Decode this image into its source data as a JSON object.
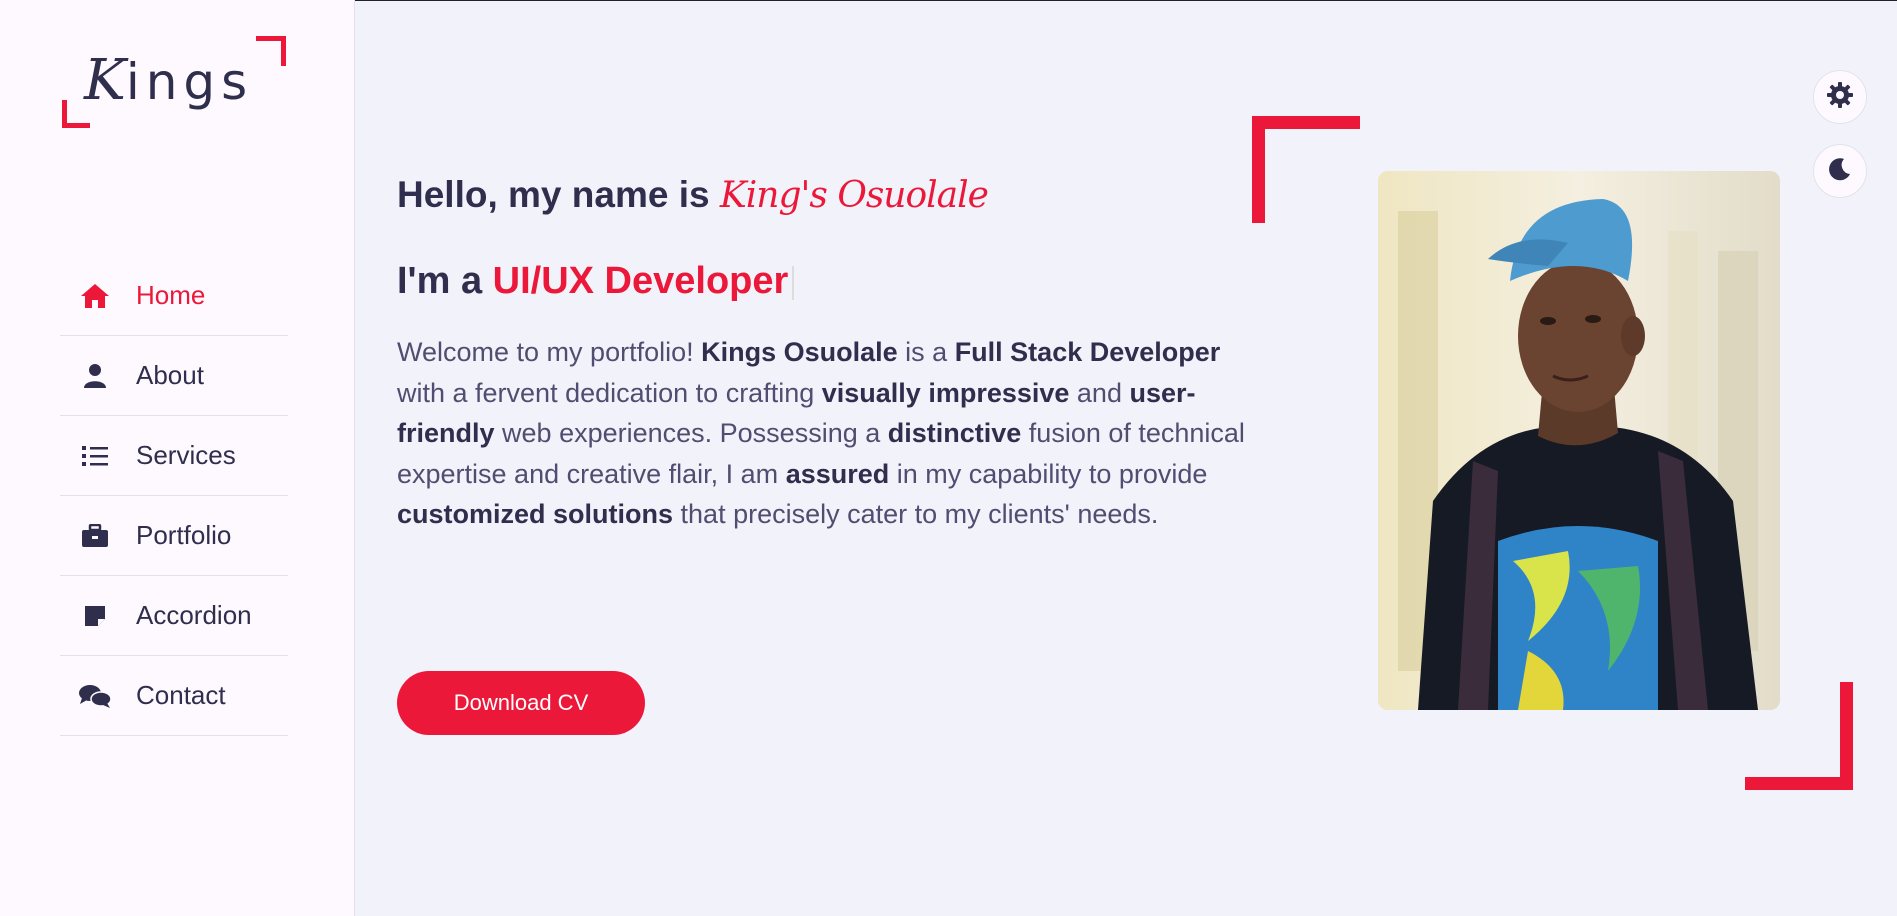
{
  "sidebar": {
    "logo": {
      "first_letter": "K",
      "rest": "ings"
    },
    "nav": [
      {
        "label": "Home",
        "icon": "home-icon",
        "active": true
      },
      {
        "label": "About",
        "icon": "user-icon",
        "active": false
      },
      {
        "label": "Services",
        "icon": "list-icon",
        "active": false
      },
      {
        "label": "Portfolio",
        "icon": "briefcase-icon",
        "active": false
      },
      {
        "label": "Accordion",
        "icon": "note-icon",
        "active": false
      },
      {
        "label": "Contact",
        "icon": "comments-icon",
        "active": false
      }
    ]
  },
  "home": {
    "hello_prefix": "Hello, my name is ",
    "name": "King's Osuolale",
    "role_prefix": "I'm a ",
    "role": "UI/UX Developer",
    "intro": {
      "p1": "Welcome to my portfolio! ",
      "b1": "Kings Osuolale",
      "p2": " is a ",
      "b2": "Full Stack Developer",
      "p3": " with a fervent dedication to crafting ",
      "b3": "visually impressive",
      "p4": " and ",
      "b4": "user-friendly",
      "p5": " web experiences. Possessing a ",
      "b5": "distinctive",
      "p6": " fusion of technical expertise and creative flair, I am ",
      "b6": "assured",
      "p7": " in my capability to provide ",
      "b7": "customized solutions",
      "p8": " that precisely cater to my clients' needs."
    },
    "cv_button": "Download CV"
  },
  "controls": {
    "settings_icon": "gear-icon",
    "theme_icon": "moon-icon"
  },
  "colors": {
    "accent": "#ec1839",
    "text_dark": "#302e4d",
    "background": "#f2f2fb",
    "sidebar_bg": "#fdf9ff"
  }
}
